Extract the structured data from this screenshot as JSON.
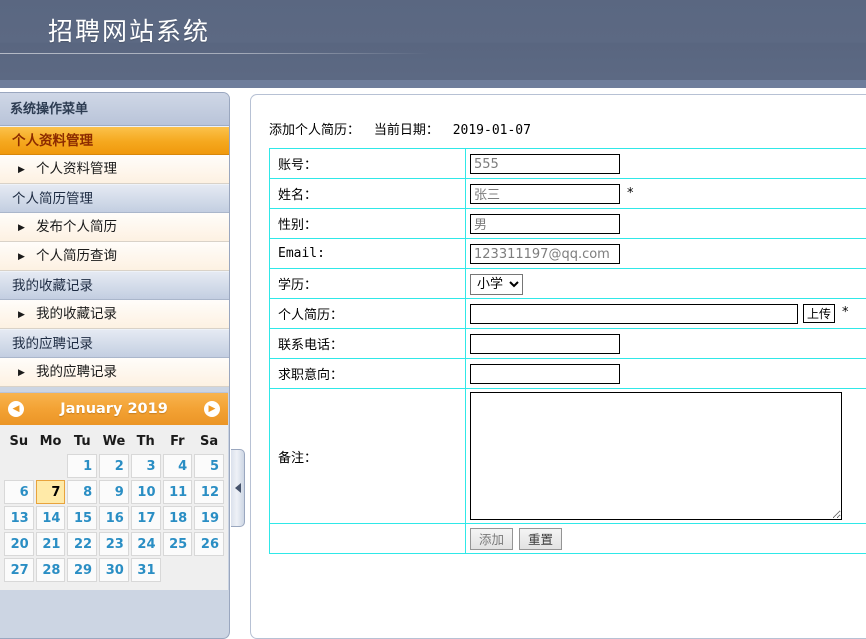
{
  "header": {
    "title": "招聘网站系统"
  },
  "sidebar": {
    "menu_title": "系统操作菜单",
    "groups": [
      {
        "label": "个人资料管理",
        "active": true,
        "items": [
          {
            "label": "个人资料管理",
            "arrow": "triangle-right-icon"
          }
        ]
      },
      {
        "label": "个人简历管理",
        "active": false,
        "items": [
          {
            "label": "发布个人简历",
            "arrow": "triangle-right-icon"
          },
          {
            "label": "个人简历查询",
            "arrow": "triangle-right-icon"
          }
        ]
      },
      {
        "label": "我的收藏记录",
        "active": false,
        "items": [
          {
            "label": "我的收藏记录",
            "arrow": "triangle-right-icon"
          }
        ]
      },
      {
        "label": "我的应聘记录",
        "active": false,
        "items": [
          {
            "label": "我的应聘记录",
            "arrow": "triangle-right-icon"
          }
        ]
      }
    ],
    "collapse_handle": "collapse-left-icon"
  },
  "calendar": {
    "title": "January 2019",
    "prev_icon": "chevron-left-circle-icon",
    "next_icon": "chevron-right-circle-icon",
    "weekdays": [
      "Su",
      "Mo",
      "Tu",
      "We",
      "Th",
      "Fr",
      "Sa"
    ],
    "weeks": [
      [
        "",
        "",
        "1",
        "2",
        "3",
        "4",
        "5"
      ],
      [
        "6",
        "7",
        "8",
        "9",
        "10",
        "11",
        "12"
      ],
      [
        "13",
        "14",
        "15",
        "16",
        "17",
        "18",
        "19"
      ],
      [
        "20",
        "21",
        "22",
        "23",
        "24",
        "25",
        "26"
      ],
      [
        "27",
        "28",
        "29",
        "30",
        "31",
        "",
        ""
      ]
    ],
    "today": "7",
    "accent_color": "#f3a234",
    "day_color": "#2a8ec4",
    "today_bg": "#ffeaa8"
  },
  "form": {
    "caption_title": "添加个人简历：",
    "caption_date_label": "当前日期：",
    "caption_date_value": "2019-01-07",
    "fields": {
      "account_label": "账号：",
      "account_value": "555",
      "name_label": "姓名：",
      "name_value": "张三",
      "name_required": "*",
      "gender_label": "性别：",
      "gender_value": "男",
      "email_label": "Email:",
      "email_value": "123311197@qq.com",
      "education_label": "学历：",
      "education_value": "小学",
      "education_options": [
        "小学"
      ],
      "resume_label": "个人简历：",
      "resume_value": "",
      "resume_upload_button": "上传",
      "resume_required": "*",
      "phone_label": "联系电话：",
      "phone_value": "",
      "intent_label": "求职意向：",
      "intent_value": "",
      "remark_label": "备注：",
      "remark_value": ""
    },
    "buttons": {
      "submit": "添加",
      "reset": "重置"
    },
    "border_color": "#2fe8e8"
  }
}
